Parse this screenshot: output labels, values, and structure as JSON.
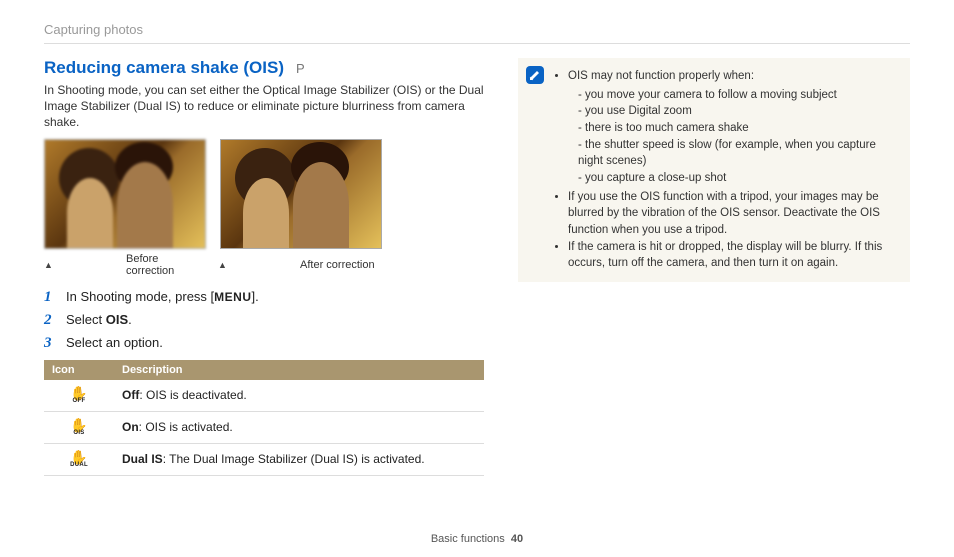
{
  "breadcrumb": "Capturing photos",
  "title": "Reducing camera shake (OIS)",
  "mode_badge": "P",
  "intro": "In Shooting mode, you can set either the Optical Image Stabilizer (OIS) or the Dual Image Stabilizer (Dual IS) to reduce or eliminate picture blurriness from camera shake.",
  "captions": {
    "before": "Before correction",
    "after": "After correction"
  },
  "steps": [
    {
      "n": "1",
      "pre": "In Shooting mode, press [",
      "menu": "MENU",
      "post": "]."
    },
    {
      "n": "2",
      "pre": "Select ",
      "strong": "OIS",
      "post": "."
    },
    {
      "n": "3",
      "pre": "Select an option.",
      "strong": "",
      "post": ""
    }
  ],
  "table": {
    "headers": [
      "Icon",
      "Description"
    ],
    "rows": [
      {
        "sub": "OFF",
        "strong": "Off",
        "rest": ": OIS is deactivated."
      },
      {
        "sub": "OIS",
        "strong": "On",
        "rest": ": OIS is activated."
      },
      {
        "sub": "DUAL",
        "strong": "Dual IS",
        "rest": ": The Dual Image Stabilizer (Dual IS) is activated."
      }
    ]
  },
  "note": {
    "b1": "OIS may not function properly when:",
    "b1_subs": [
      "you move your camera to follow a moving subject",
      "you use Digital zoom",
      "there is too much camera shake",
      "the shutter speed is slow (for example, when you capture night scenes)",
      "you capture a close-up shot"
    ],
    "b2": "If you use the OIS function with a tripod, your images may be blurred by the vibration of the OIS sensor. Deactivate the OIS function when you use a tripod.",
    "b3": "If the camera is hit or dropped, the display will be blurry. If this occurs, turn off the camera, and then turn it on again."
  },
  "footer": {
    "section": "Basic functions",
    "page": "40"
  }
}
